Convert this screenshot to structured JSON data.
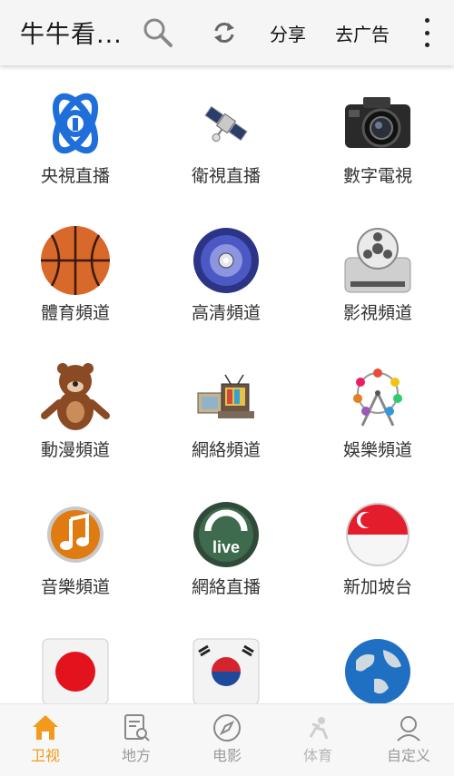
{
  "appbar": {
    "title": "牛牛看...",
    "share_label": "分享",
    "remove_ads_label": "去广告"
  },
  "channels": [
    {
      "label": "央視直播",
      "icon": "cctv-logo-icon"
    },
    {
      "label": "衛視直播",
      "icon": "satellite-icon"
    },
    {
      "label": "數字電視",
      "icon": "camera-icon"
    },
    {
      "label": "體育頻道",
      "icon": "basketball-icon"
    },
    {
      "label": "高清頻道",
      "icon": "disc-icon"
    },
    {
      "label": "影視頻道",
      "icon": "film-reel-icon"
    },
    {
      "label": "動漫頻道",
      "icon": "bear-icon"
    },
    {
      "label": "網絡頻道",
      "icon": "tv-sets-icon"
    },
    {
      "label": "娛樂頻道",
      "icon": "ferris-wheel-icon"
    },
    {
      "label": "音樂頻道",
      "icon": "music-note-icon"
    },
    {
      "label": "網絡直播",
      "icon": "live-icon"
    },
    {
      "label": "新加坡台",
      "icon": "singapore-flag-icon"
    },
    {
      "label": "",
      "icon": "japan-flag-icon"
    },
    {
      "label": "",
      "icon": "korea-flag-icon"
    },
    {
      "label": "",
      "icon": "globe-icon"
    }
  ],
  "live_badge": "live",
  "bottom_nav": [
    {
      "label": "卫视",
      "icon": "home-icon",
      "active": true
    },
    {
      "label": "地方",
      "icon": "local-search-icon",
      "active": false
    },
    {
      "label": "电影",
      "icon": "compass-icon",
      "active": false
    },
    {
      "label": "体育",
      "icon": "sports-icon",
      "active": false
    },
    {
      "label": "自定义",
      "icon": "user-icon",
      "active": false
    }
  ],
  "colors": {
    "accent": "#f39a1c",
    "appbar": "#f5f5f5",
    "text": "#333333"
  }
}
